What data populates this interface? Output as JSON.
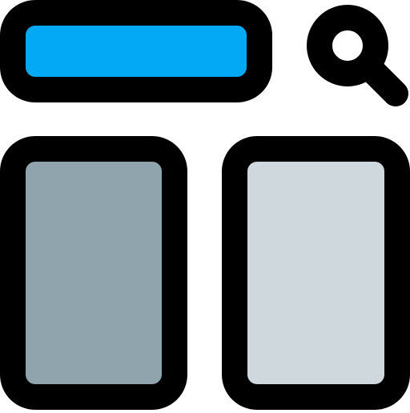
{
  "icon": {
    "name": "search-layout-icon",
    "colors": {
      "outline": "#000000",
      "search_bar_fill": "#03A9F4",
      "left_panel_fill": "#90A4AE",
      "right_panel_fill": "#CFD8DC",
      "magnifier_lens_fill": "#ffffff"
    },
    "parts": {
      "search_bar": "search-bar",
      "search_button": "search-icon",
      "left_panel": "left-panel",
      "right_panel": "right-panel"
    }
  }
}
